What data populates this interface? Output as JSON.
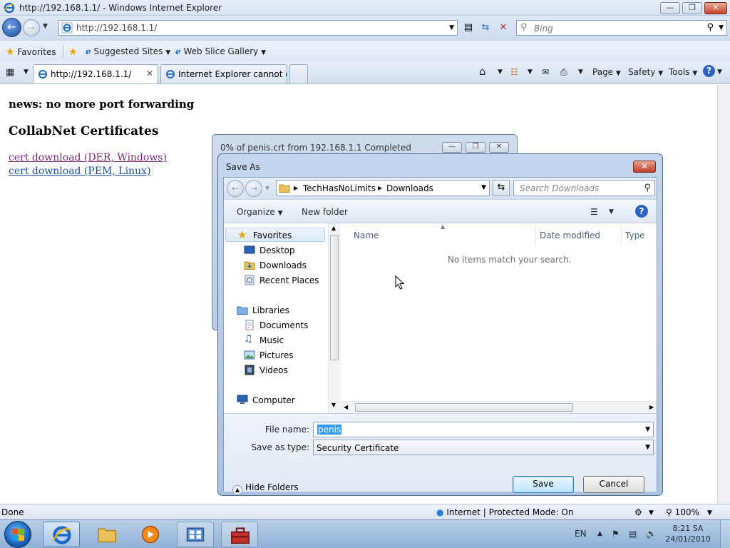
{
  "window": {
    "title": "http://192.168.1.1/ - Windows Internet Explorer"
  },
  "navbar": {
    "address": "http://192.168.1.1/",
    "search_placeholder": "Bing"
  },
  "favorites_bar": {
    "favorites_label": "Favorites",
    "suggested_sites": "Suggested Sites",
    "web_slice_gallery": "Web Slice Gallery"
  },
  "tabs": [
    {
      "label": "http://192.168.1.1/"
    },
    {
      "label": "Internet Explorer cannot di..."
    }
  ],
  "command_bar": {
    "page": "Page",
    "safety": "Safety",
    "tools": "Tools"
  },
  "page": {
    "news": "news: no more port forwarding",
    "heading": "CollabNet Certificates",
    "links": [
      "cert download (DER, Windows)",
      "cert download (PEM, Linux)"
    ]
  },
  "status_bar": {
    "status": "Done",
    "zone": "Internet | Protected Mode: On",
    "zoom": "100%"
  },
  "progress_dialog": {
    "title": "0% of penis.crt from 192.168.1.1 Completed"
  },
  "save_dialog": {
    "title": "Save As",
    "breadcrumb": [
      "TechHasNoLimits",
      "Downloads"
    ],
    "search_placeholder": "Search Downloads",
    "toolbar": {
      "organize": "Organize",
      "new_folder": "New folder"
    },
    "nav": {
      "favorites": "Favorites",
      "desktop": "Desktop",
      "downloads": "Downloads",
      "recent_places": "Recent Places",
      "libraries": "Libraries",
      "documents": "Documents",
      "music": "Music",
      "pictures": "Pictures",
      "videos": "Videos",
      "computer": "Computer"
    },
    "columns": {
      "name": "Name",
      "date_modified": "Date modified",
      "type": "Type"
    },
    "empty_message": "No items match your search.",
    "file_name_label": "File name:",
    "file_name_value": "penis",
    "save_as_type_label": "Save as type:",
    "save_as_type_value": "Security Certificate",
    "hide_folders": "Hide Folders",
    "save_button": "Save",
    "cancel_button": "Cancel"
  },
  "taskbar": {
    "language": "EN",
    "time": "8:21 SA",
    "date": "24/01/2010"
  },
  "colors": {
    "link_visited": "#7a2b7d",
    "link": "#1a4fa0",
    "selection": "#3399ff"
  }
}
